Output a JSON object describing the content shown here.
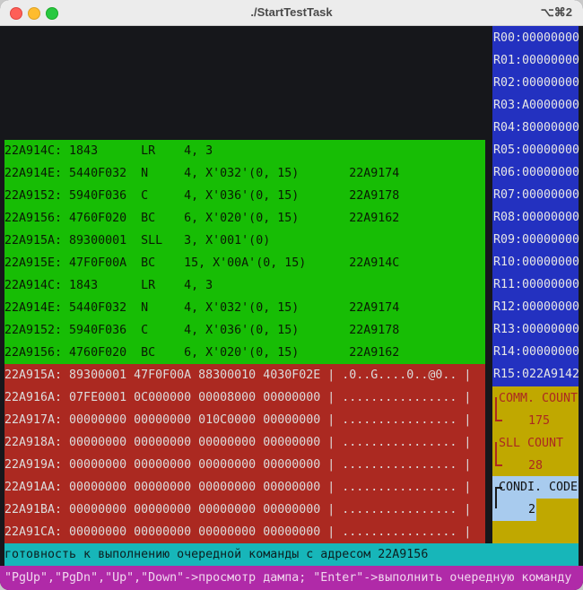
{
  "window": {
    "title": "./StartTestTask",
    "shortcut": "⌥⌘2"
  },
  "code_lines": [
    "22A914C: 1843      LR    4, 3",
    "22A914E: 5440F032  N     4, X'032'(0, 15)       22A9174",
    "22A9152: 5940F036  C     4, X'036'(0, 15)       22A9178",
    "22A9156: 4760F020  BC    6, X'020'(0, 15)       22A9162",
    "22A915A: 89300001  SLL   3, X'001'(0)",
    "22A915E: 47F0F00A  BC    15, X'00A'(0, 15)      22A914C",
    "22A914C: 1843      LR    4, 3",
    "22A914E: 5440F032  N     4, X'032'(0, 15)       22A9174",
    "22A9152: 5940F036  C     4, X'036'(0, 15)       22A9178",
    "22A9156: 4760F020  BC    6, X'020'(0, 15)       22A9162"
  ],
  "dump_lines": [
    "22A915A: 89300001 47F0F00A 88300010 4030F02E | .0..G....0..@0.. |",
    "22A916A: 07FE0001 0C000000 00008000 00000000 | ................ |",
    "22A917A: 00000000 00000000 010C0000 00000000 | ................ |",
    "22A918A: 00000000 00000000 00000000 00000000 | ................ |",
    "22A919A: 00000000 00000000 00000000 00000000 | ................ |",
    "22A91AA: 00000000 00000000 00000000 00000000 | ................ |",
    "22A91BA: 00000000 00000000 00000000 00000000 | ................ |",
    "22A91CA: 00000000 00000000 00000000 00000000 | ................ |"
  ],
  "registers": [
    "R00:00000000",
    "R01:00000000",
    "R02:00000000",
    "R03:A0000000",
    "R04:80000000",
    "R05:00000000",
    "R06:00000000",
    "R07:00000000",
    "R08:00000000",
    "R09:00000000",
    "R10:00000000",
    "R11:00000000",
    "R12:00000000",
    "R13:00000000",
    "R14:00000000",
    "R15:022A9142"
  ],
  "counters": {
    "comm_label": "COMM. COUNT",
    "comm_value": "175",
    "sll_label": "SLL COUNT",
    "sll_value": "28",
    "cond_label": "CONDI. CODE",
    "cond_value": "2"
  },
  "status": "готовность к выполнению очередной команды с адресом 22A9156",
  "hint": "\"PgUp\",\"PgDn\",\"Up\",\"Down\"->просмотр дампа; \"Enter\"->выполнить очередную команду",
  "colors": {
    "code_bg": "#17bd05",
    "dump_bg": "#ab2921",
    "registers_bg": "#2331c0",
    "counters_bg": "#c0a800",
    "cond_bg": "#a8cbee",
    "status_bg": "#17b6b9",
    "hint_bg": "#b02aa8"
  }
}
